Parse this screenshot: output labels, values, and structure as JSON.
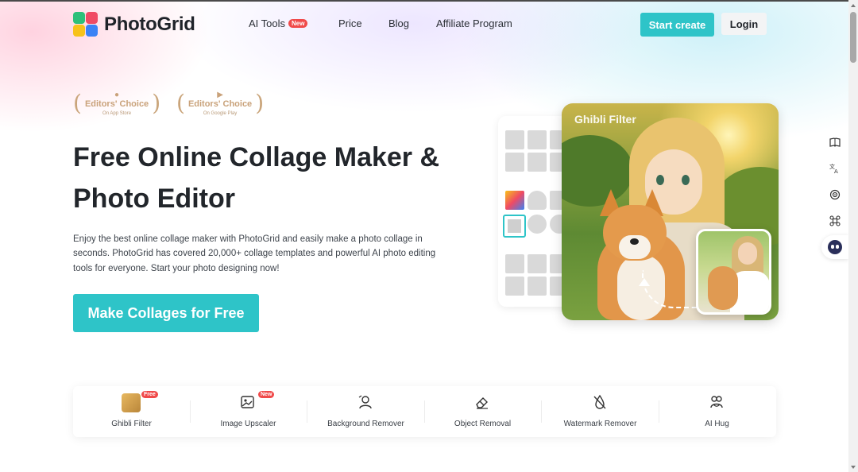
{
  "brand": {
    "name": "PhotoGrid"
  },
  "nav": [
    {
      "label": "AI Tools",
      "badge": "New"
    },
    {
      "label": "Price"
    },
    {
      "label": "Blog"
    },
    {
      "label": "Affiliate Program"
    }
  ],
  "header": {
    "start_label": "Start create",
    "login_label": "Login"
  },
  "awards": [
    {
      "title": "Editors' Choice",
      "sub": "On App Store",
      "icon": "apple-icon"
    },
    {
      "title": "Editors' Choice",
      "sub": "On Google Play",
      "icon": "google-play-icon"
    }
  ],
  "hero": {
    "title_line1": "Free Online Collage Maker &",
    "title_line2": "Photo Editor",
    "description": "Enjoy the best online collage maker with PhotoGrid and easily make a photo collage in seconds. PhotoGrid has covered 20,000+ collage templates and powerful AI photo editing tools for everyone. Start your photo designing now!",
    "cta_label": "Make Collages for Free"
  },
  "showcase": {
    "label": "Ghibli Filter"
  },
  "tools": [
    {
      "label": "Ghibli Filter",
      "badge": "Free",
      "icon": "ghibli-thumb-icon"
    },
    {
      "label": "Image Upscaler",
      "badge": "New",
      "icon": "image-upscale-icon"
    },
    {
      "label": "Background Remover",
      "icon": "person-cutout-icon"
    },
    {
      "label": "Object Removal",
      "icon": "eraser-icon"
    },
    {
      "label": "Watermark Remover",
      "icon": "watermark-off-icon"
    },
    {
      "label": "AI Hug",
      "icon": "hug-icon"
    }
  ],
  "colors": {
    "accent": "#2ec4c8",
    "badge": "#f04a4a",
    "award": "#c9a27a"
  }
}
